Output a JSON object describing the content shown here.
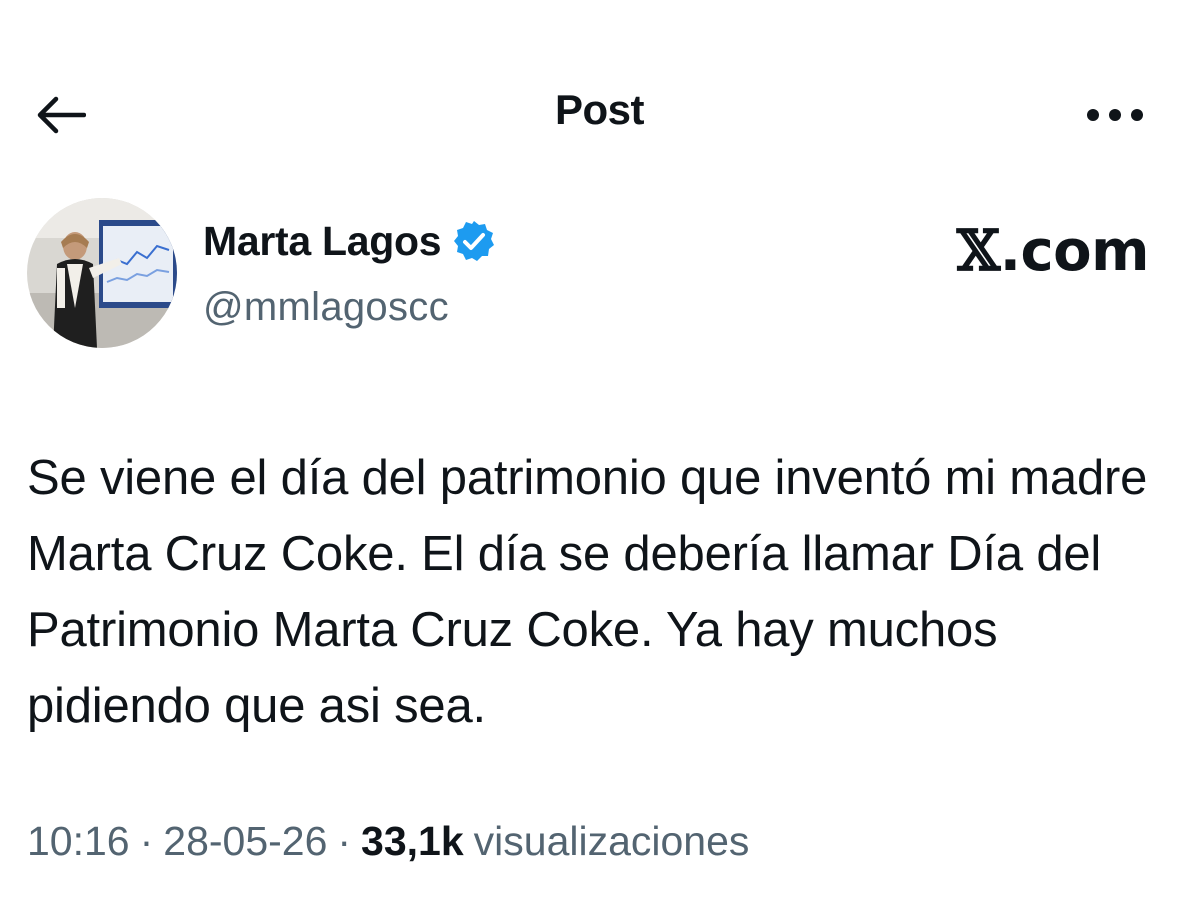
{
  "header": {
    "back_icon": "arrow-left-icon",
    "title": "Post",
    "more_icon": "more-horizontal-icon"
  },
  "author": {
    "name": "Marta Lagos",
    "handle": "@mmlagoscc",
    "verified_icon": "verified-badge-icon",
    "verified_color": "#1d9bf0"
  },
  "source": {
    "label": "com",
    "logo": "𝕏",
    "separator": "."
  },
  "post": {
    "text": "Se viene el día del patrimonio que inventó mi madre Marta Cruz Coke. El día se debería llamar Día del Patrimonio Marta Cruz Coke. Ya hay muchos pidiendo que asi sea."
  },
  "meta": {
    "time": "10:16",
    "date": "28-05-26",
    "views_count": "33,1k",
    "views_label": "visualizaciones",
    "separator": "·"
  },
  "colors": {
    "text_primary": "#0f1419",
    "text_secondary": "#536471",
    "accent": "#1d9bf0",
    "background": "#ffffff"
  }
}
